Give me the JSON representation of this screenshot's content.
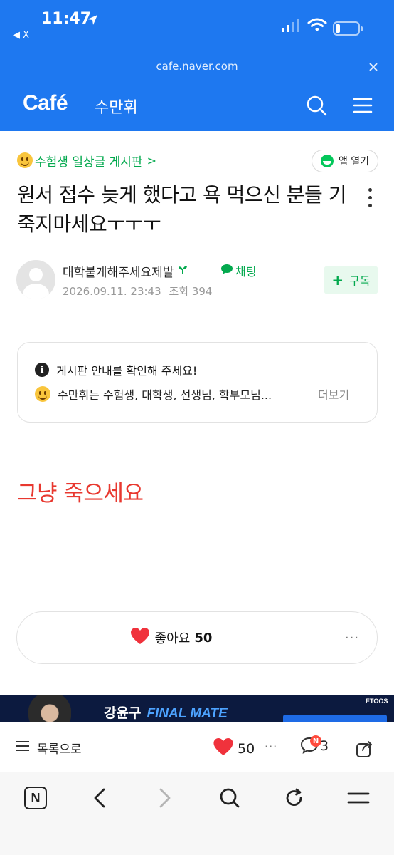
{
  "status_bar": {
    "time": "11:47",
    "back_label": "X",
    "battery_level": 0.2
  },
  "browser": {
    "url": "cafe.naver.com"
  },
  "cafe_header": {
    "logo": "Café",
    "cafe_name": "수만휘"
  },
  "article": {
    "board_name": "수험생 일상글 게시판",
    "board_arrow": ">",
    "app_open_label": "앱 열기",
    "title": "원서 접수 늦게 했다고 욕 먹으신 분들 기죽지마세요ㅜㅜㅜ",
    "author": "대학붙게해주세요제발",
    "chat_label": "채팅",
    "date": "2026.09.11. 23:43",
    "views_label": "조회 394",
    "subscribe_label": "구독",
    "body_text": "그냥 죽으세요"
  },
  "notice": {
    "heading": "게시판 안내를 확인해 주세요!",
    "preview": "수만휘는 수험생, 대학생, 선생님, 학부모님...",
    "more_label": "더보기"
  },
  "like_box": {
    "label": "좋아요",
    "count": "50",
    "more": "···"
  },
  "banner": {
    "name": "강윤구",
    "title_em": "FINAL MATE",
    "brand": "ETOOS"
  },
  "article_bar": {
    "list_label": "목록으로",
    "like_count": "50",
    "more": "···",
    "badge": "N",
    "comment_count": "3"
  },
  "colors": {
    "brand_blue": "#1e78f0",
    "naver_green": "#03a94e",
    "body_red": "#e8382f",
    "heart_red": "#f0323c"
  }
}
